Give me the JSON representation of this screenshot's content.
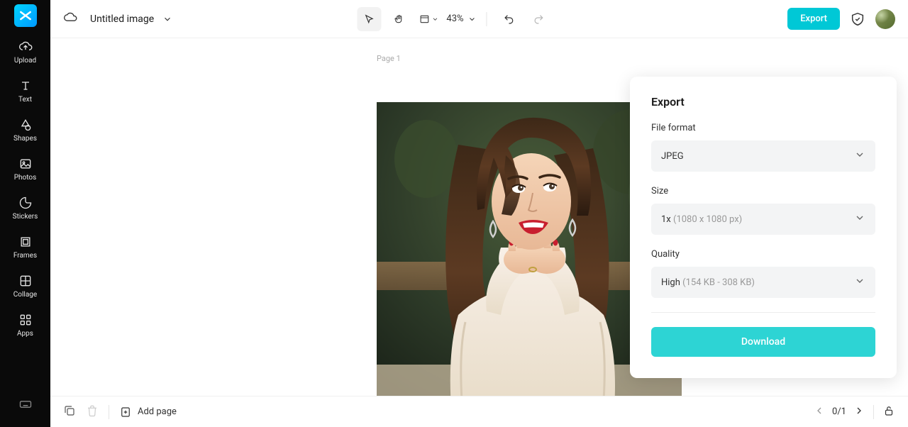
{
  "sidebar": {
    "items": [
      {
        "label": "Upload"
      },
      {
        "label": "Text"
      },
      {
        "label": "Shapes"
      },
      {
        "label": "Photos"
      },
      {
        "label": "Stickers"
      },
      {
        "label": "Frames"
      },
      {
        "label": "Collage"
      },
      {
        "label": "Apps"
      }
    ]
  },
  "header": {
    "title": "Untitled image",
    "zoom": "43%",
    "export_label": "Export"
  },
  "canvas": {
    "page_label": "Page 1"
  },
  "export_panel": {
    "title": "Export",
    "file_format_label": "File format",
    "file_format_value": "JPEG",
    "size_label": "Size",
    "size_value": "1x",
    "size_hint": "(1080 x 1080 px)",
    "quality_label": "Quality",
    "quality_value": "High",
    "quality_hint": "(154 KB - 308 KB)",
    "download_label": "Download"
  },
  "footer": {
    "add_page": "Add page",
    "page_indicator": "0/1"
  }
}
